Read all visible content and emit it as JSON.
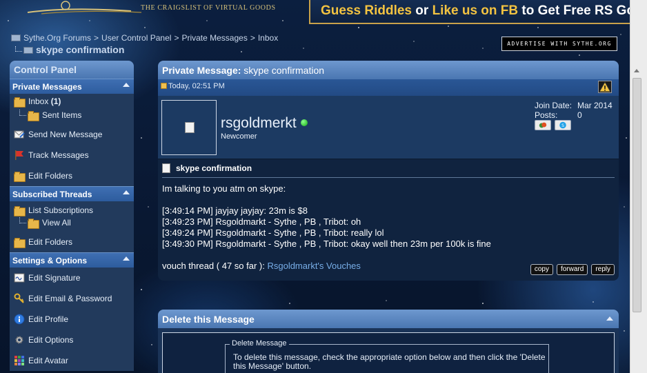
{
  "header": {
    "tagline": "THE CRAIGSLIST OF VIRTUAL GOODS",
    "banner": {
      "part1": "Guess Riddles",
      "part2": " or ",
      "part3": "Like us on FB",
      "part4": " to Get Free RS Gold"
    },
    "advertise_label": "ADVERTISE WITH SYTHE.ORG"
  },
  "breadcrumb": {
    "items": [
      "Sythe.Org Forums",
      "User Control Panel",
      "Private Messages",
      "Inbox"
    ],
    "separator": ">",
    "current": "skype confirmation"
  },
  "sidebar": {
    "title": "Control Panel",
    "sections": [
      {
        "title": "Private Messages",
        "items": [
          {
            "label": "Inbox",
            "count": "(1)",
            "icon": "folder-icon"
          },
          {
            "label": "Sent Items",
            "icon": "folder-icon",
            "sub": true
          },
          {
            "label": "Send New Message",
            "icon": "send-message-icon"
          },
          {
            "label": "Track Messages",
            "icon": "flag-icon"
          },
          {
            "label": "Edit Folders",
            "icon": "folder-edit-icon"
          }
        ]
      },
      {
        "title": "Subscribed Threads",
        "items": [
          {
            "label": "List Subscriptions",
            "icon": "folder-icon"
          },
          {
            "label": "View All",
            "icon": "folder-icon",
            "sub": true
          },
          {
            "label": "Edit Folders",
            "icon": "folder-edit-icon"
          }
        ]
      },
      {
        "title": "Settings & Options",
        "items": [
          {
            "label": "Edit Signature",
            "icon": "signature-icon"
          },
          {
            "label": "Edit Email & Password",
            "icon": "key-icon"
          },
          {
            "label": "Edit Profile",
            "icon": "info-icon"
          },
          {
            "label": "Edit Options",
            "icon": "gear-icon"
          },
          {
            "label": "Edit Avatar",
            "icon": "avatar-grid-icon"
          }
        ]
      }
    ]
  },
  "message": {
    "header_prefix": "Private Message:",
    "header_subject": "skype confirmation",
    "date": "Today, 02:51 PM",
    "user": {
      "name": "rsgoldmerkt",
      "title": "Newcomer",
      "join_label": "Join Date:",
      "join_value": "Mar 2014",
      "posts_label": "Posts:",
      "posts_value": "0"
    },
    "title": "skype confirmation",
    "lines": [
      "Im talking to you atm on skype:",
      "",
      "[3:49:14 PM] jayjay jayjay: 23m is $8",
      "[3:49:23 PM] Rsgoldmarkt - Sythe , PB , Tribot: oh",
      "[3:49:24 PM] Rsgoldmarkt - Sythe , PB , Tribot: really lol",
      "[3:49:30 PM] Rsgoldmarkt - Sythe , PB , Tribot: okay well then 23m per 100k is fine",
      ""
    ],
    "vouch_prefix": "vouch thread ( 47 so far ): ",
    "vouch_link": "Rsgoldmarkt's Vouches",
    "actions": {
      "copy": "copy",
      "forward": "forward",
      "reply": "reply"
    }
  },
  "delete_panel": {
    "title": "Delete this Message",
    "legend": "Delete Message",
    "text": "To delete this message, check the appropriate option below and then click the 'Delete this Message' button."
  },
  "colors": {
    "panel_header": "#5a86c0",
    "section_header": "#3465a8",
    "link": "#78aee8",
    "banner_gold": "#f3c341"
  }
}
